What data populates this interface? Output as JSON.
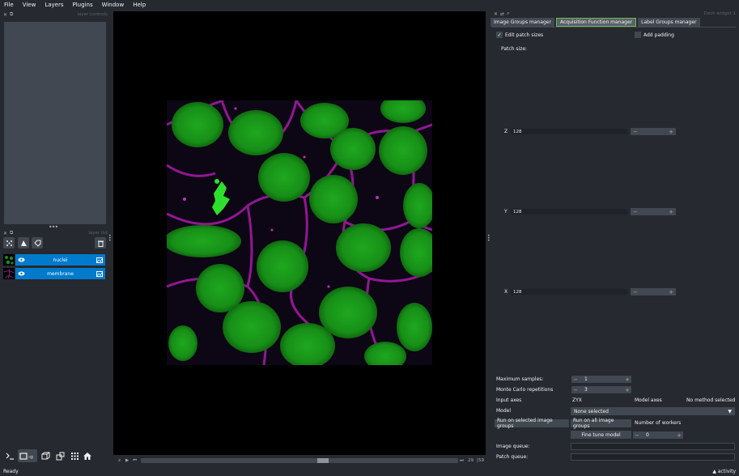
{
  "menubar": [
    "File",
    "View",
    "Layers",
    "Plugins",
    "Window",
    "Help"
  ],
  "left_dock": {
    "controls_title": "layer controls",
    "list_title": "layer list",
    "layers": [
      {
        "name": "nuclei"
      },
      {
        "name": "membrane"
      }
    ]
  },
  "dims": {
    "axis": "z",
    "current": "29",
    "total": "59"
  },
  "right_dock": {
    "title": "Dock widget 1",
    "tabs": [
      "Image Groups manager",
      "Acquisition Function manager",
      "Label Groups manager"
    ],
    "edit_patch_sizes": "Edit patch sizes",
    "add_padding": "Add padding",
    "patch_size_label": "Patch size:",
    "patch": [
      {
        "axis": "Z",
        "value": "128"
      },
      {
        "axis": "Y",
        "value": "128"
      },
      {
        "axis": "X",
        "value": "128"
      }
    ],
    "max_samples_label": "Maximum samples:",
    "max_samples_value": "1",
    "mc_label": "Monte Carlo repetitions",
    "mc_value": "3",
    "input_axes_label": "Input axes",
    "input_axes_value": "ZYX",
    "model_axes_label": "Model axes",
    "model_axes_value": "No method selected",
    "model_label": "Model",
    "model_value": "None selected",
    "run_selected": "Run on selected image groups",
    "run_all": "Run on all image groups",
    "workers_label": "Number of workers",
    "fine_tune": "Fine tune model",
    "workers_value": "0",
    "image_queue_label": "Image queue:",
    "patch_queue_label": "Patch queue:"
  },
  "status": {
    "text": "Ready",
    "activity": "activity"
  },
  "colors": {
    "background": "#262930",
    "accent": "#007acc",
    "tab_highlight": "#6ebd4a"
  }
}
